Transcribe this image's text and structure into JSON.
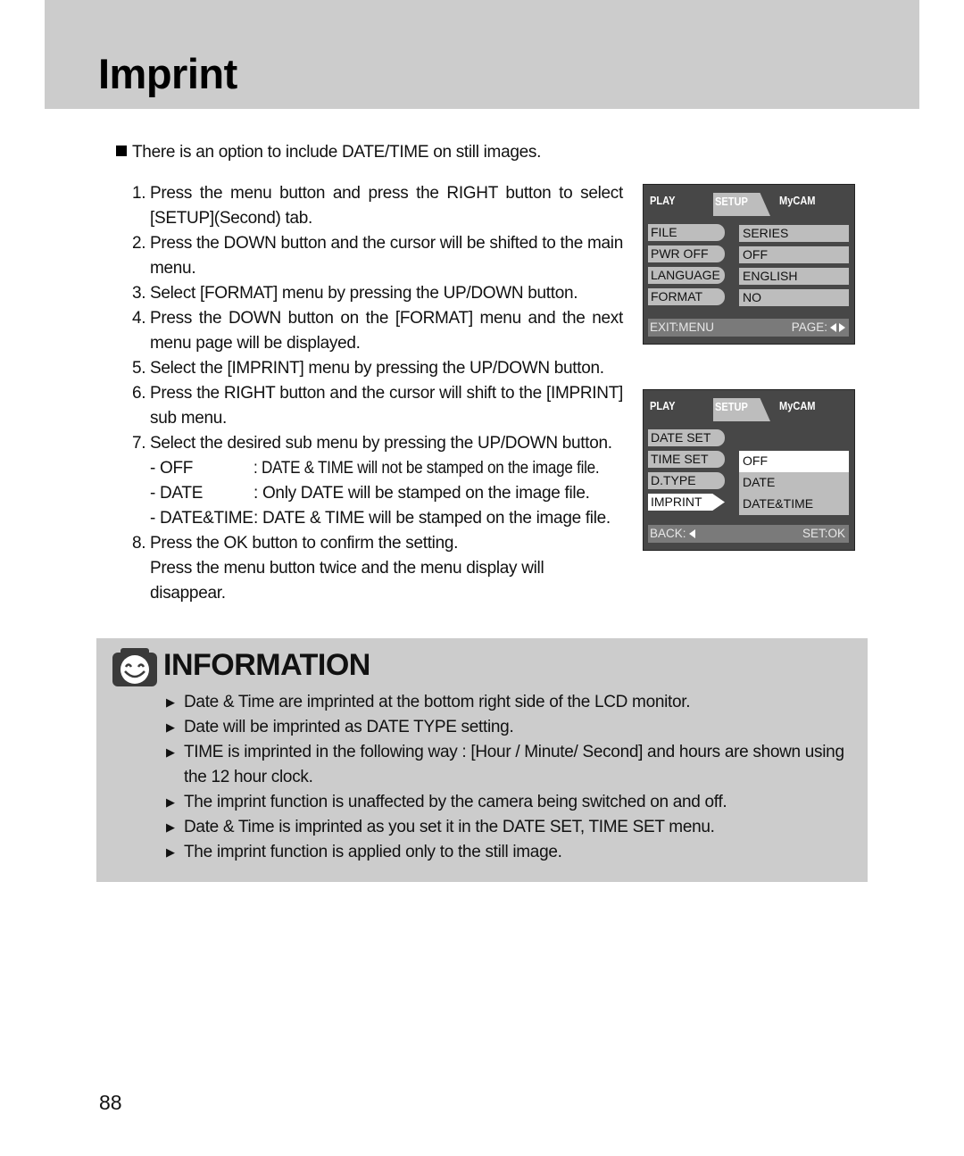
{
  "header": {
    "title": "Imprint"
  },
  "intro": "There is an option to include DATE/TIME on still images.",
  "steps": [
    {
      "num": "1.",
      "text": "Press the menu button and press the RIGHT button to select [SETUP](Second) tab."
    },
    {
      "num": "2.",
      "text": "Press the DOWN button and the cursor will be shifted to the main menu."
    },
    {
      "num": "3.",
      "text": "Select [FORMAT] menu by pressing the UP/DOWN button."
    },
    {
      "num": "4.",
      "text": "Press the DOWN button on the [FORMAT] menu and the next menu page will be displayed."
    },
    {
      "num": "5.",
      "text": "Select the [IMPRINT] menu by pressing the UP/DOWN button."
    },
    {
      "num": "6.",
      "text": "Press the RIGHT button and the cursor will shift to the [IMPRINT] sub menu."
    },
    {
      "num": "7.",
      "text": "Select the desired sub menu by pressing the UP/DOWN button."
    },
    {
      "num": "8.",
      "text": "Press the OK button to confirm the setting."
    }
  ],
  "options": [
    {
      "key": "- OFF",
      "desc": ": DATE & TIME will not be stamped on the image file."
    },
    {
      "key": "- DATE",
      "desc": ": Only DATE will be stamped on the image file."
    },
    {
      "key": "- DATE&TIME",
      "desc": ": DATE & TIME will be stamped on the image file."
    }
  ],
  "step8_note": "Press the menu button twice and the menu display will disappear.",
  "lcd1": {
    "tabs": [
      "PLAY",
      "SETUP",
      "MyCAM"
    ],
    "rows": [
      {
        "label": "FILE",
        "value": "SERIES"
      },
      {
        "label": "PWR OFF",
        "value": "OFF"
      },
      {
        "label": "LANGUAGE",
        "value": "ENGLISH"
      },
      {
        "label": "FORMAT",
        "value": "NO"
      }
    ],
    "footer_left": "EXIT:MENU",
    "footer_right": "PAGE:"
  },
  "lcd2": {
    "tabs": [
      "PLAY",
      "SETUP",
      "MyCAM"
    ],
    "rows": [
      "DATE SET",
      "TIME SET",
      "D.TYPE",
      "IMPRINT"
    ],
    "selected_row": "IMPRINT",
    "submenu": [
      "OFF",
      "DATE",
      "DATE&TIME"
    ],
    "selected_option": "OFF",
    "footer_left": "BACK:",
    "footer_right": "SET:OK"
  },
  "information": {
    "title": "INFORMATION",
    "items": [
      "Date & Time are imprinted at the bottom right side of the LCD monitor.",
      "Date will be imprinted as DATE TYPE setting.",
      "TIME is imprinted in the following way : [Hour / Minute/ Second] and hours are shown using the 12 hour clock.",
      "The imprint function is unaffected by the camera being switched on and off.",
      "Date & Time is imprinted as you set it in the DATE SET, TIME SET menu.",
      "The imprint function is applied only to the still image."
    ]
  },
  "page_number": "88"
}
